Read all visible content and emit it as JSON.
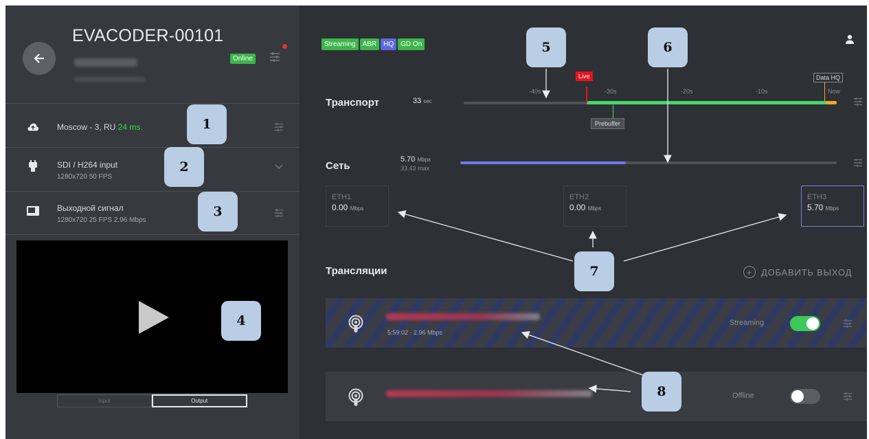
{
  "device": {
    "title": "EVACODER-00101",
    "status": "Online",
    "location": "Moscow - 3, RU",
    "latency": "24 ms.",
    "input_label": "SDI / H264 input",
    "input_sub": "1280x720 50 FPS",
    "output_label": "Выходной сигнал",
    "output_sub": "1280x720 25 FPS 2.96 Mbps",
    "tabs": [
      "Input",
      "Output"
    ]
  },
  "badges": [
    {
      "label": "Streaming",
      "color": "#3cb54a"
    },
    {
      "label": "ABR",
      "color": "#3cb54a"
    },
    {
      "label": "HQ",
      "color": "#5b6bdc"
    },
    {
      "label": "GD On",
      "color": "#3cb54a"
    }
  ],
  "transport": {
    "title": "Транспорт",
    "seconds": "33",
    "seconds_unit": "sec",
    "ticks": [
      "-40s",
      "-30s",
      "-20s",
      "-10s",
      "Now"
    ],
    "live_label": "Live",
    "data_hq_label": "Data HQ",
    "prebuffer_label": "Prebuffer"
  },
  "network": {
    "title": "Сеть",
    "rate": "5.70",
    "rate_unit": "Mbps",
    "max": "33.43 max",
    "fill_fraction": 0.44,
    "interfaces": [
      {
        "name": "ETH1",
        "value": "0.00",
        "unit": "Mbps",
        "active": false
      },
      {
        "name": "ETH2",
        "value": "0.00",
        "unit": "Mbps",
        "active": false
      },
      {
        "name": "ETH3",
        "value": "5.70",
        "unit": "Mbps",
        "active": true
      }
    ]
  },
  "broadcasts": {
    "title": "Трансляции",
    "add_label": "ДОБАВИТЬ ВЫХОД",
    "items": [
      {
        "meta": "5:59:02  ·  2.96 Mbps",
        "state": "Streaming",
        "on": true
      },
      {
        "meta": "",
        "state": "Offline",
        "on": false
      }
    ]
  },
  "callouts": [
    "1",
    "2",
    "3",
    "4",
    "5",
    "6",
    "7",
    "8"
  ],
  "colors": {
    "accent_green": "#3cb54a",
    "accent_blue": "#5b6bdc",
    "transport_bar": "#46d66a",
    "live_red": "#e5141f",
    "buffer_orange": "#f5a623",
    "network_bar": "#6c78f0"
  },
  "icons": {
    "back": "arrow-left-icon",
    "location": "cloud-upload-icon",
    "input": "plug-icon",
    "output": "monitor-icon",
    "settings": "tune-sliders-icon",
    "user": "user-icon",
    "broadcast": "podcast-icon",
    "add": "plus-circle-icon"
  }
}
